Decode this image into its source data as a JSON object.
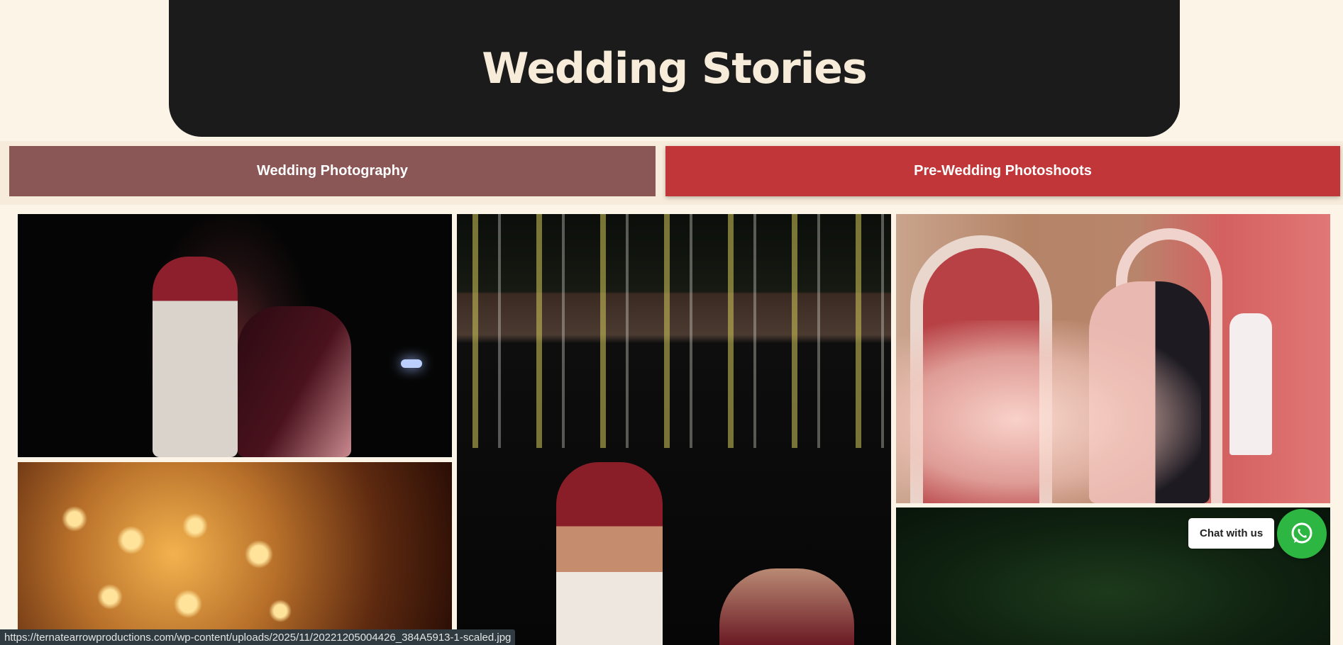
{
  "hero": {
    "title": "Wedding Stories"
  },
  "tabs": [
    {
      "label": "Wedding Photography"
    },
    {
      "label": "Pre-Wedding Photoshoots"
    }
  ],
  "chat": {
    "label": "Chat with us",
    "icon": "whatsapp-icon"
  },
  "status_bar": {
    "url": "https://ternatearrowproductions.com/wp-content/uploads/2025/11/20221205004426_384A5913-1-scaled.jpg"
  },
  "colors": {
    "hero_bg": "#1b1b1b",
    "tab_inactive": "#8b5656",
    "tab_active": "#c13638",
    "whatsapp": "#2db742",
    "page_bg": "#fbf4e7"
  }
}
